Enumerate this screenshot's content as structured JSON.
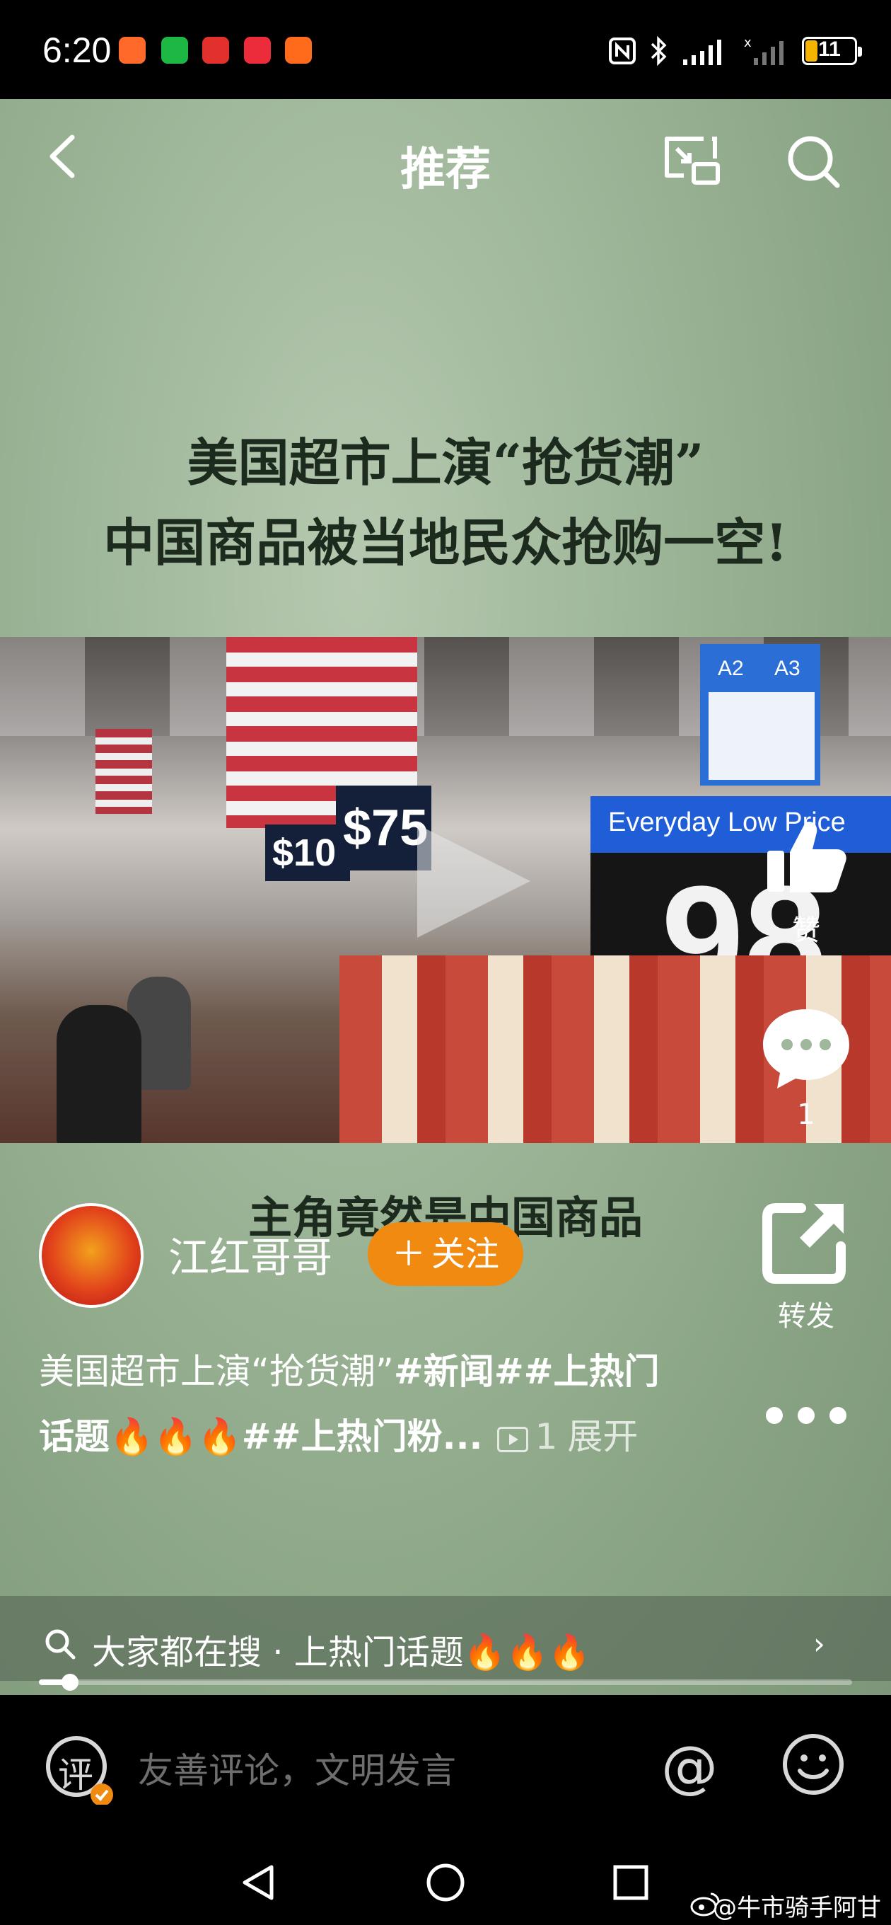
{
  "status_bar": {
    "time": "6:20",
    "battery_level": "11",
    "icons": [
      "app-icon-orange",
      "wechat-icon",
      "app-icon-red",
      "app-icon-red-book",
      "app-icon-orange-person",
      "nfc-icon",
      "bluetooth-icon",
      "signal-icon",
      "signal-icon-2",
      "battery-icon"
    ]
  },
  "top_bar": {
    "title": "推荐",
    "icons": [
      "back-icon",
      "cast-icon",
      "search-icon"
    ]
  },
  "video": {
    "headline_line1": "美国超市上演“抢货潮”",
    "headline_line2": "中国商品被当地民众抢购一空!",
    "sign_aisles": [
      "A2",
      "A3"
    ],
    "price_board_label": "Everyday Low Price",
    "price_board_value": "98",
    "price_small_1": "$10",
    "price_small_2": "$75",
    "subcaption": "主角竟然是中国商品"
  },
  "rail": {
    "like_label": "赞",
    "comment_count": "1",
    "share_label": "转发"
  },
  "author": {
    "name": "江红哥哥",
    "follow_label": "关注"
  },
  "description": {
    "line1_plain": "美国超市上演“抢货潮”",
    "line1_tags": "#新闻##上热门",
    "line2_tags_a": "话题",
    "line2_fire": "🔥🔥🔥",
    "line2_tags_b": "##上热门粉...",
    "video_count": "1",
    "expand_label": "展开"
  },
  "hot_search": {
    "text": "大家都在搜 · 上热门话题🔥🔥🔥",
    "chevron": "›"
  },
  "progress": {
    "fraction": 0.038
  },
  "comment_bar": {
    "badge": "评",
    "placeholder": "友善评论，文明发言",
    "at_symbol": "@"
  },
  "watermark": "@牛市骑手阿甘",
  "colors": {
    "accent_follow": "#f08a10",
    "link_blue": "#1f5ed6"
  }
}
